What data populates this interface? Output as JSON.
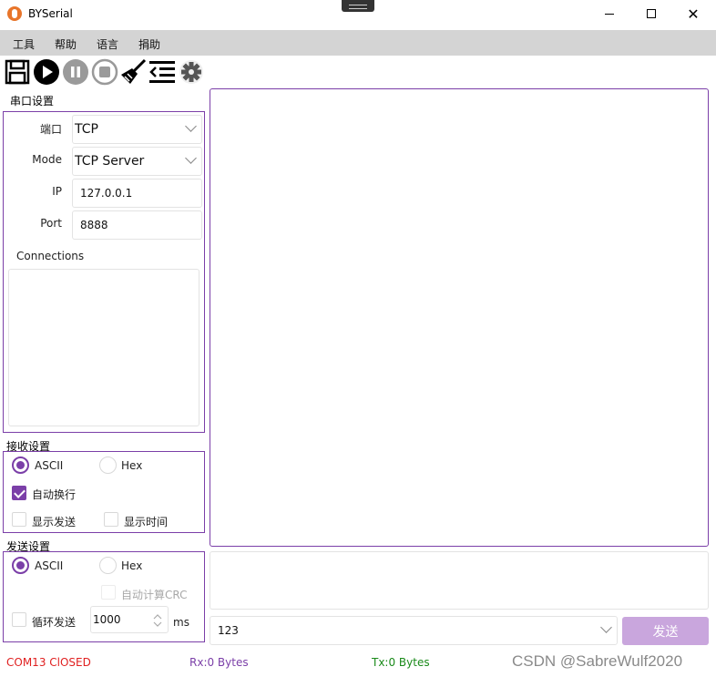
{
  "window": {
    "title": "BYSerial",
    "close_glyph": "✕"
  },
  "menu": [
    "工具",
    "帮助",
    "语言",
    "捐助"
  ],
  "toolbar": {
    "icons": [
      "save-icon",
      "play-icon",
      "pause-icon",
      "stop-icon",
      "clear-icon",
      "indent-icon",
      "gear-icon"
    ]
  },
  "serial": {
    "group_title": "串口设置",
    "port_label": "端口",
    "port_value": "TCP",
    "mode_label": "Mode",
    "mode_value": "TCP Server",
    "ip_label": "IP",
    "ip_value": "127.0.0.1",
    "port_num_label": "Port",
    "port_num_value": "8888",
    "connections_label": "Connections"
  },
  "receive": {
    "group_title": "接收设置",
    "ascii_label": "ASCII",
    "hex_label": "Hex",
    "auto_newline_label": "自动换行",
    "show_send_label": "显示发送",
    "show_time_label": "显示时间"
  },
  "send": {
    "group_title": "发送设置",
    "ascii_label": "ASCII",
    "hex_label": "Hex",
    "auto_crc_label": "自动计算CRC",
    "loop_label": "循环发送",
    "interval_value": "1000",
    "unit_label": "ms",
    "history_value": "123",
    "send_button": "发送"
  },
  "status": {
    "com": "COM13 ClOSED",
    "rx": "Rx:0 Bytes",
    "tx": "Tx:0 Bytes"
  },
  "watermark": "CSDN @SabreWulf2020",
  "colors": {
    "accent": "#7b3fa8",
    "send_button": "#c9a6dd",
    "status_com": "#e02020",
    "status_rx": "#7b3fa8",
    "status_tx": "#1a8a1a"
  }
}
